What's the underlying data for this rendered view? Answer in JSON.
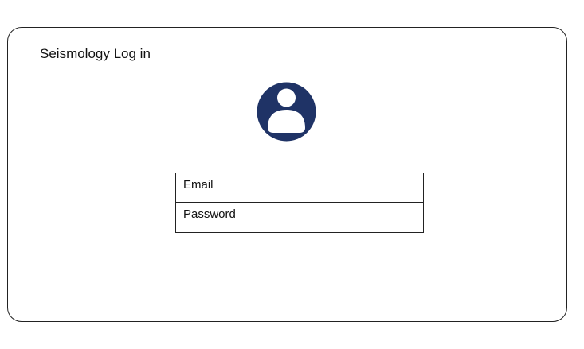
{
  "app": {
    "title": "Seismology Log in"
  },
  "avatar": {
    "icon": "user-avatar-icon",
    "color": "#1f3366"
  },
  "login_form": {
    "email_label": "Email",
    "password_label": "Password"
  }
}
